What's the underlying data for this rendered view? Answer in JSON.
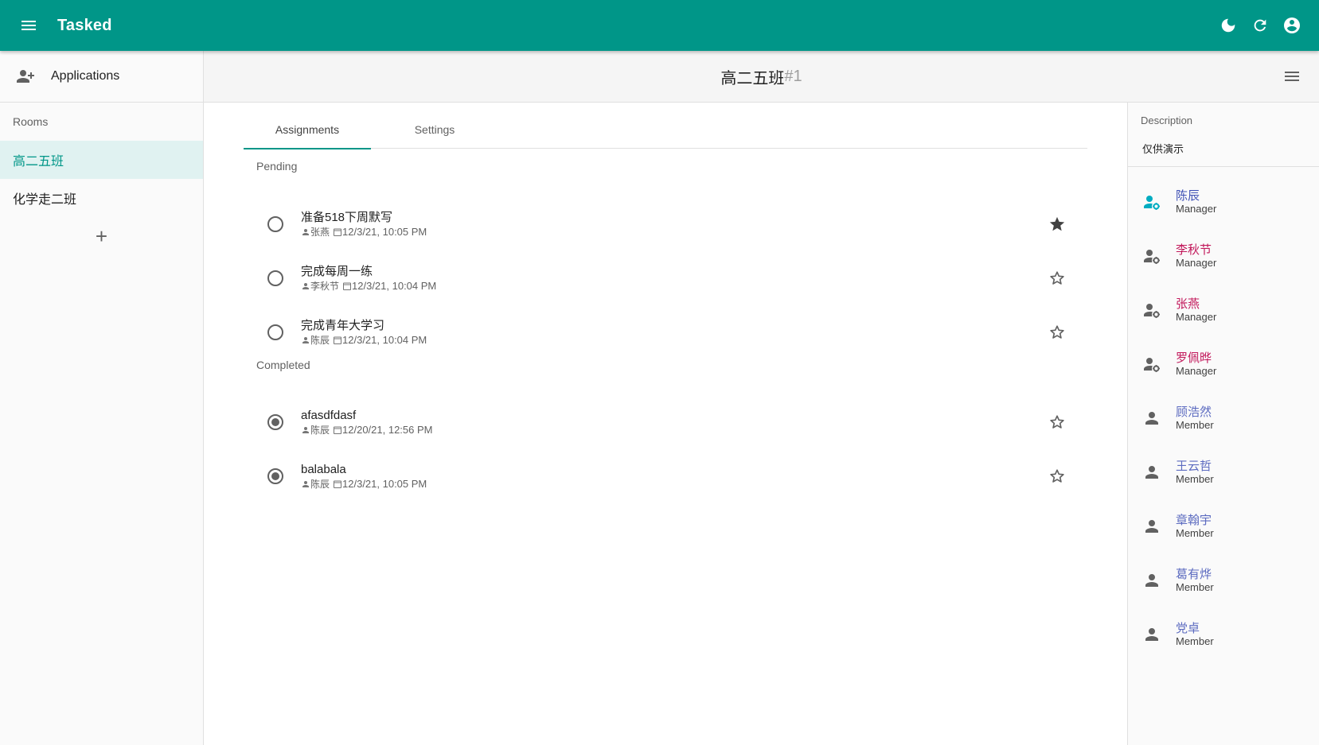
{
  "app": {
    "title": "Tasked"
  },
  "colors": {
    "primary": "#009688",
    "manager_name": "#c2185b",
    "member_name": "#5c6bc0",
    "active_manager_name": "#3f51b5",
    "active_icon": "#00acc1"
  },
  "appbar": {
    "icons": [
      "menu-icon",
      "moon-icon",
      "refresh-icon",
      "account-circle-icon"
    ]
  },
  "sidebar": {
    "applications_label": "Applications",
    "rooms_header": "Rooms",
    "rooms": [
      {
        "label": "高二五班",
        "active": true
      },
      {
        "label": "化学走二班",
        "active": false
      }
    ],
    "add_label": "+"
  },
  "room": {
    "name": "高二五班",
    "number": "#1"
  },
  "tabs": [
    {
      "label": "Assignments",
      "active": true
    },
    {
      "label": "Settings",
      "active": false
    }
  ],
  "pending": {
    "header": "Pending",
    "tasks": [
      {
        "name": "准备518下周默写",
        "author": "张燕",
        "date": "12/3/21, 10:05 PM",
        "starred": true
      },
      {
        "name": "完成每周一练",
        "author": "李秋节",
        "date": "12/3/21, 10:04 PM",
        "starred": false
      },
      {
        "name": "完成青年大学习",
        "author": "陈辰",
        "date": "12/3/21, 10:04 PM",
        "starred": false
      }
    ]
  },
  "completed": {
    "header": "Completed",
    "tasks": [
      {
        "name": "afasdfdasf",
        "author": "陈辰",
        "date": "12/20/21, 12:56 PM",
        "starred": false
      },
      {
        "name": "balabala",
        "author": "陈辰",
        "date": "12/3/21, 10:05 PM",
        "starred": false
      }
    ]
  },
  "panel": {
    "description_header": "Description",
    "description": "仅供演示",
    "members": [
      {
        "name": "陈辰",
        "role": "Manager",
        "self": true
      },
      {
        "name": "李秋节",
        "role": "Manager",
        "self": false
      },
      {
        "name": "张燕",
        "role": "Manager",
        "self": false
      },
      {
        "name": "罗佩晔",
        "role": "Manager",
        "self": false
      },
      {
        "name": "顾浩然",
        "role": "Member",
        "self": false
      },
      {
        "name": "王云哲",
        "role": "Member",
        "self": false
      },
      {
        "name": "章翰宇",
        "role": "Member",
        "self": false
      },
      {
        "name": "葛有烨",
        "role": "Member",
        "self": false
      },
      {
        "name": "党卓",
        "role": "Member",
        "self": false
      }
    ]
  }
}
